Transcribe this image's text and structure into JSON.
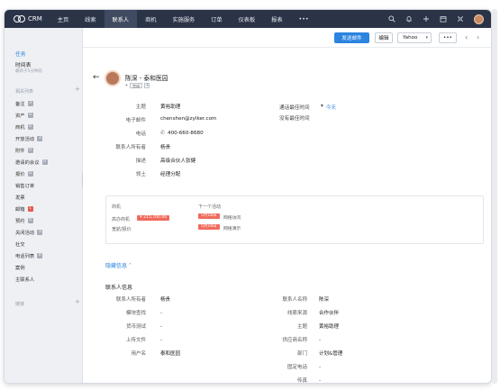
{
  "app": {
    "logo_text": "CRM"
  },
  "nav": {
    "tabs": [
      "主页",
      "线索",
      "联系人",
      "商机",
      "实施服务",
      "订单",
      "仪表板",
      "报表",
      "•••"
    ],
    "active_tab": "联系人"
  },
  "sidebar": {
    "links": [
      "任务",
      "时间表"
    ],
    "links_sub": "最新于5分钟前",
    "section_related": "相关列表",
    "items": [
      {
        "label": "备注",
        "count": "3"
      },
      {
        "label": "资产",
        "count": "0"
      },
      {
        "label": "商机",
        "count": "0"
      },
      {
        "label": "开放活动",
        "count": "3"
      },
      {
        "label": "附件",
        "count": "0"
      },
      {
        "label": "邀请的会议",
        "count": "0"
      },
      {
        "label": "报价",
        "count": "0"
      },
      {
        "label": "销售订单",
        "count": ""
      },
      {
        "label": "发票",
        "count": ""
      },
      {
        "label": "邮箱",
        "count": "1"
      },
      {
        "label": "预约",
        "count": "0"
      },
      {
        "label": "关闭活动",
        "count": "3"
      },
      {
        "label": "社交",
        "count": ""
      },
      {
        "label": "电话列表",
        "count": "0"
      },
      {
        "label": "案例",
        "count": ""
      },
      {
        "label": "主联系人",
        "count": ""
      }
    ],
    "section_links": "链接"
  },
  "toolbar": {
    "send_email": "发送邮件",
    "edit": "编辑",
    "yahoo": "Yahoo",
    "more": "•••"
  },
  "contact": {
    "name": "陈深 - 泰和医园",
    "tag": "完成",
    "tag_add": "+",
    "fields_left": [
      {
        "label": "主题",
        "value": "黄裕助理"
      },
      {
        "label": "电子邮件",
        "value": "chenshen@zylker.com"
      },
      {
        "label": "电话",
        "value": "400-660-8680"
      },
      {
        "label": "联系人所有者",
        "value": "杨贵"
      },
      {
        "label": "描述",
        "value": "高级合伙人张健"
      },
      {
        "label": "领土",
        "value": "经理分配"
      }
    ],
    "next_time_label": "通话最佳时间",
    "next_time_value": "今天",
    "no_time_label": "没有最佳时间"
  },
  "panel": {
    "col1_title": "商机",
    "col2_title": "下一个活动",
    "rows": [
      {
        "label": "高办商机",
        "amount": "¥ 215,700.00",
        "date": "5月18日",
        "activity": "网络访问"
      },
      {
        "label": "宽航/报价",
        "amount": "",
        "date": "5月18日",
        "activity": "网络演示"
      }
    ]
  },
  "hide_details": "隐藏信息",
  "details": {
    "title": "联系人信息",
    "left": [
      {
        "label": "联系人所有者",
        "value": "杨贵"
      },
      {
        "label": "模块查找",
        "value": "-"
      },
      {
        "label": "货币测试",
        "value": "-"
      },
      {
        "label": "上传文件",
        "value": "-"
      },
      {
        "label": "用户名",
        "value": "泰和医园"
      }
    ],
    "right": [
      {
        "label": "联系人名称",
        "value": "陈深"
      },
      {
        "label": "线索来源",
        "value": "合作伙伴"
      },
      {
        "label": "主题",
        "value": "黄裕助理"
      },
      {
        "label": "供应商名称",
        "value": "-"
      },
      {
        "label": "部门",
        "value": "计划&管理"
      },
      {
        "label": "固定电话",
        "value": "-"
      },
      {
        "label": "传真",
        "value": "-"
      }
    ]
  },
  "colors": {
    "nav_bg": "#2b3347",
    "accent": "#2d83e0",
    "pill": "#ef6a5c"
  },
  "icons": [
    "search-icon",
    "bell-icon",
    "plus-icon",
    "calendar-icon",
    "settings-icon",
    "user-avatar",
    "back-arrow-icon",
    "phone-icon",
    "tag-icon"
  ]
}
